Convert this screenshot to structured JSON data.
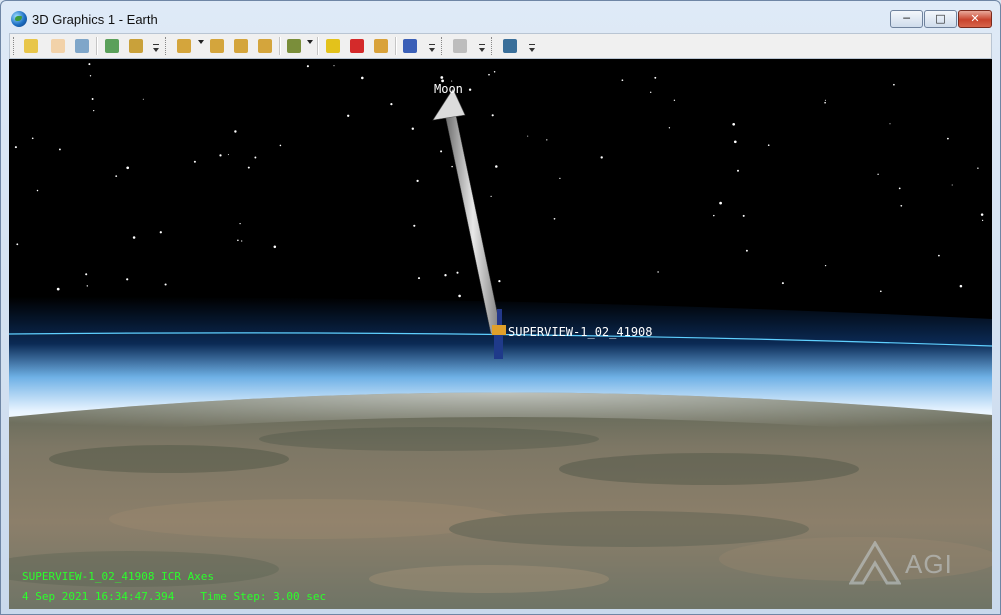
{
  "window": {
    "title": "3D Graphics 1 - Earth",
    "controls": {
      "minimize": "─",
      "maximize": "□",
      "close": "✕"
    }
  },
  "toolbar": {
    "buttons": [
      {
        "name": "properties-icon",
        "color": "#e8c64a"
      },
      {
        "name": "pan-hand-icon",
        "color": "#f2d2a9"
      },
      {
        "name": "zoom-icon",
        "color": "#7fa6c9"
      },
      {
        "name": "view-from-to-icon",
        "color": "#5aa05a"
      },
      {
        "name": "snapshot-icon",
        "color": "#c9a13a"
      },
      {
        "name": "home-view-icon",
        "color": "#d4a53c"
      },
      {
        "name": "view-north-icon",
        "color": "#d4a53c"
      },
      {
        "name": "orbit-view-icon",
        "color": "#d4a53c"
      },
      {
        "name": "view-top-icon",
        "color": "#d4a53c"
      },
      {
        "name": "aircraft-view-icon",
        "color": "#7a8e3a"
      },
      {
        "name": "measure-pencil-icon",
        "color": "#e3c21b"
      },
      {
        "name": "annotate-pencil-icon",
        "color": "#d42a2a"
      },
      {
        "name": "distance-ruler-icon",
        "color": "#d9a23a"
      },
      {
        "name": "globe-settings-icon",
        "color": "#3b5fb7"
      },
      {
        "name": "record-disabled-icon",
        "color": "#bdbdbd"
      },
      {
        "name": "earth-globe-icon",
        "color": "#3a6f9a"
      }
    ]
  },
  "scene": {
    "moon_label": "Moon",
    "satellite_label": "SUPERVIEW-1_02_41908",
    "hud": {
      "axes_label": "SUPERVIEW-1_02_41908 ICR Axes",
      "datetime": "4 Sep 2021 16:34:47.394",
      "time_step": "Time Step: 3.00 sec"
    },
    "logo_text": "AGI"
  },
  "colors": {
    "hud_green": "#2bff2b",
    "horizon_line": "#5fd0ff",
    "space": "#000000"
  }
}
